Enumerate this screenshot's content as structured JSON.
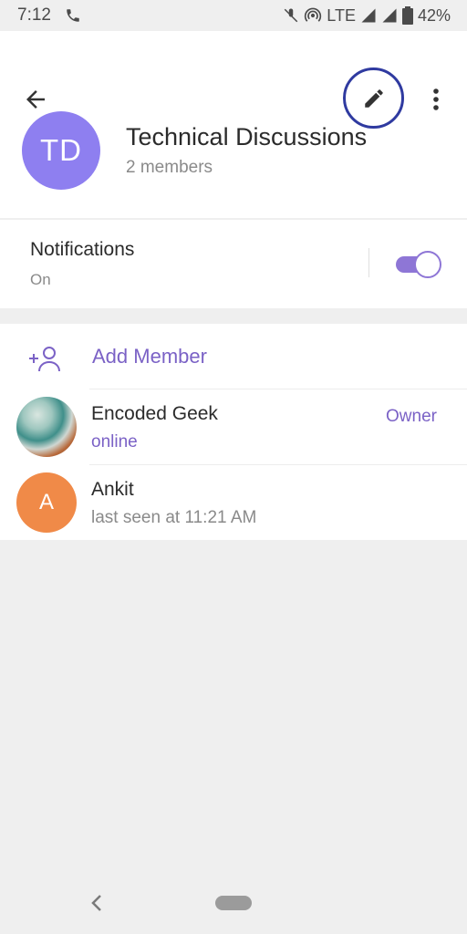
{
  "status_bar": {
    "time": "7:12",
    "network": "LTE",
    "battery": "42%",
    "icons": [
      "phone-icon",
      "mute-icon",
      "hotspot-icon",
      "signal-icon",
      "signal-icon",
      "battery-icon"
    ]
  },
  "toolbar": {
    "back_icon": "arrow-left-icon",
    "edit_icon": "pencil-icon",
    "more_icon": "more-vertical-icon"
  },
  "group": {
    "initials": "TD",
    "name": "Technical Discussions",
    "member_count": "2 members",
    "avatar_color": "#8e7ff0"
  },
  "notifications": {
    "title": "Notifications",
    "state": "On",
    "enabled": true
  },
  "members": {
    "add_label": "Add Member",
    "add_icon": "add-person-icon",
    "list": [
      {
        "name": "Encoded Geek",
        "status": "online",
        "role": "Owner",
        "avatar": "photo"
      },
      {
        "name": "Ankit",
        "status": "last seen at 11:21 AM",
        "role": "",
        "initial": "A",
        "avatar_color": "#f08a48"
      }
    ]
  },
  "colors": {
    "accent": "#7b62c6",
    "edit_highlight": "#2f3aa0",
    "background": "#efefef"
  }
}
